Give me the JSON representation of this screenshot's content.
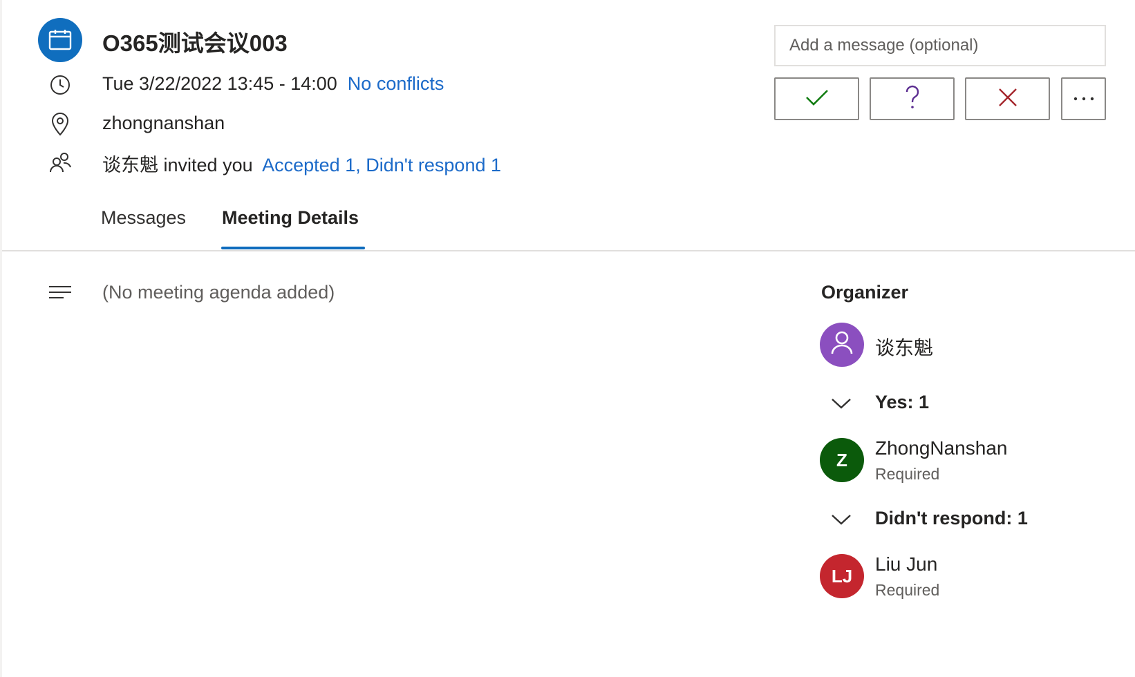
{
  "meeting": {
    "title": "O365测试会议003",
    "datetime": "Tue 3/22/2022 13:45 - 14:00",
    "conflicts": "No conflicts",
    "location": "zhongnanshan",
    "organizer_name": "谈东魁",
    "invited_text": "invited you",
    "responses_summary": "Accepted 1, Didn't respond 1"
  },
  "response": {
    "message_placeholder": "Add a message (optional)",
    "accept_icon": "check-icon",
    "tentative_icon": "question-icon",
    "decline_icon": "x-icon",
    "more_icon": "ellipsis-icon"
  },
  "tabs": [
    {
      "label": "Messages",
      "active": false
    },
    {
      "label": "Meeting Details",
      "active": true
    }
  ],
  "agenda": {
    "empty_text": "(No meeting agenda added)"
  },
  "attendees": {
    "organizer_heading": "Organizer",
    "organizer": {
      "name": "谈东魁",
      "avatar_color": "#8b4fbf"
    },
    "groups": [
      {
        "heading": "Yes: 1",
        "people": [
          {
            "initials": "Z",
            "name": "ZhongNanshan",
            "role": "Required",
            "avatar_color": "#0b5a0b"
          }
        ]
      },
      {
        "heading": "Didn't respond: 1",
        "people": [
          {
            "initials": "LJ",
            "name": "Liu Jun",
            "role": "Required",
            "avatar_color": "#c4262e"
          }
        ]
      }
    ]
  },
  "colors": {
    "accent": "#0f6cbd",
    "link": "#1b6ac9",
    "accept": "#107c10",
    "tentative": "#5c2e91",
    "decline": "#a4262c"
  }
}
